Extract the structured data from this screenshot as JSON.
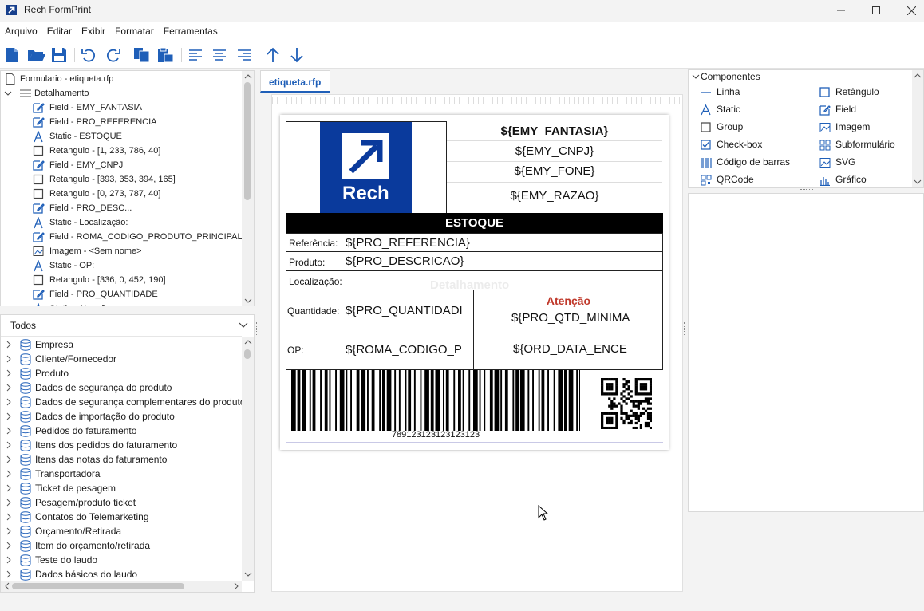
{
  "window": {
    "title": "Rech FormPrint"
  },
  "menu": [
    "Arquivo",
    "Editar",
    "Exibir",
    "Formatar",
    "Ferramentas"
  ],
  "tree": {
    "root": "Formulario - etiqueta.rfp",
    "section": "Detalhamento",
    "items": [
      "Field - EMY_FANTASIA",
      "Field - PRO_REFERENCIA",
      "Static - ESTOQUE",
      "Retangulo - [1, 233, 786, 40]",
      "Field - EMY_CNPJ",
      "Retangulo - [393, 353, 394, 165]",
      "Retangulo - [0, 273, 787, 40]",
      "Field - PRO_DESC...",
      "Static - Localização:",
      "Field - ROMA_CODIGO_PRODUTO_PRINCIPAL",
      "Imagem - <Sem nome>",
      "Static - OP:",
      "Retangulo - [336, 0, 452, 190]",
      "Field - PRO_QUANTIDADE",
      "Static - Atenção"
    ]
  },
  "datasource": {
    "filter": "Todos",
    "items": [
      "Empresa",
      "Cliente/Fornecedor",
      "Produto",
      "Dados de segurança do produto",
      "Dados de segurança complementares do produto",
      "Dados de importação do produto",
      "Pedidos do faturamento",
      "Itens dos pedidos do faturamento",
      "Itens das notas do faturamento",
      "Transportadora",
      "Ticket de pesagem",
      "Pesagem/produto ticket",
      "Contatos do Telemarketing",
      "Orçamento/Retirada",
      "Item do orçamento/retirada",
      "Teste do laudo",
      "Dados básicos do laudo"
    ]
  },
  "editor": {
    "tab": "etiqueta.rfp",
    "band_label": "Detalhamento"
  },
  "label": {
    "logo_text": "Rech",
    "fantasia": "${EMY_FANTASIA}",
    "cnpj": "${EMY_CNPJ}",
    "fone": "${EMY_FONE}",
    "razao": "${EMY_RAZAO}",
    "estoque": "ESTOQUE",
    "referencia_label": "Referência:",
    "referencia": "${PRO_REFERENCIA}",
    "produto_label": "Produto:",
    "produto": "${PRO_DESCRICAO}",
    "localizacao_label": "Localização:",
    "quantidade_label": "Quantidade:",
    "quantidade": "${PRO_QUANTIDADI",
    "atencao": "Atenção",
    "qtd_minima": "${PRO_QTD_MINIMA",
    "op_label": "OP:",
    "op": "${ROMA_CODIGO_P",
    "data_ence": "${ORD_DATA_ENCE",
    "barcode": "789123123123123123"
  },
  "components": {
    "title": "Componentes",
    "items": [
      {
        "label": "Linha",
        "icon": "line-icon"
      },
      {
        "label": "Retângulo",
        "icon": "rectangle-icon"
      },
      {
        "label": "Static",
        "icon": "static-text-icon"
      },
      {
        "label": "Field",
        "icon": "field-icon"
      },
      {
        "label": "Group",
        "icon": "group-icon"
      },
      {
        "label": "Imagem",
        "icon": "image-icon"
      },
      {
        "label": "Check-box",
        "icon": "checkbox-icon"
      },
      {
        "label": "Subformulário",
        "icon": "subform-icon"
      },
      {
        "label": "Código de barras",
        "icon": "barcode-icon"
      },
      {
        "label": "SVG",
        "icon": "svg-icon"
      },
      {
        "label": "QRCode",
        "icon": "qrcode-icon"
      },
      {
        "label": "Gráfico",
        "icon": "chart-icon"
      }
    ]
  },
  "colors": {
    "accent": "#1f5fb8",
    "brand_blue": "#0a3a9c",
    "atencao": "#c0392b"
  }
}
